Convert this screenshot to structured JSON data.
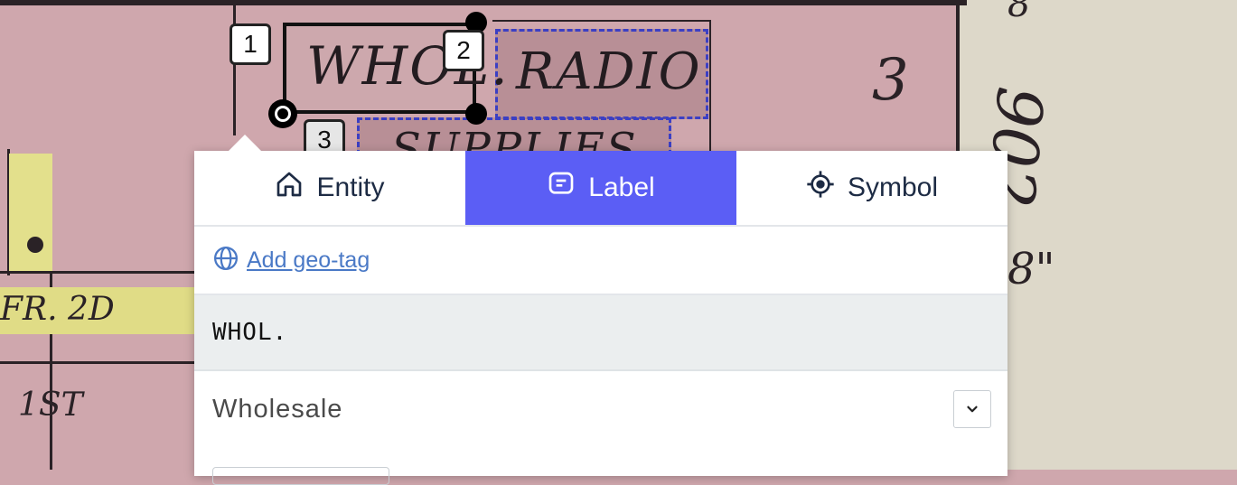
{
  "map": {
    "street_labels": [
      "FR. 2D",
      "1ST"
    ],
    "box_labels": [
      "WHOL.",
      "RADIO",
      "SUPPLIES"
    ],
    "margin_numbers": [
      "3",
      "902",
      "8\"",
      "8"
    ],
    "annotation_badges": [
      "1",
      "2",
      "3"
    ]
  },
  "tabs": [
    {
      "label": "Entity",
      "icon": "home-icon",
      "active": false
    },
    {
      "label": "Label",
      "icon": "message-square-icon",
      "active": true
    },
    {
      "label": "Symbol",
      "icon": "crosshair-icon",
      "active": false
    }
  ],
  "geo_tag": {
    "label": "Add geo-tag",
    "icon": "globe-icon"
  },
  "label_text": "WHOL.",
  "expansion": {
    "text": "Wholesale",
    "icon": "chevron-down-icon"
  },
  "colors": {
    "accent": "#5b5ef5",
    "link": "#4a79c6",
    "selection_dash": "#3b3fc4"
  }
}
